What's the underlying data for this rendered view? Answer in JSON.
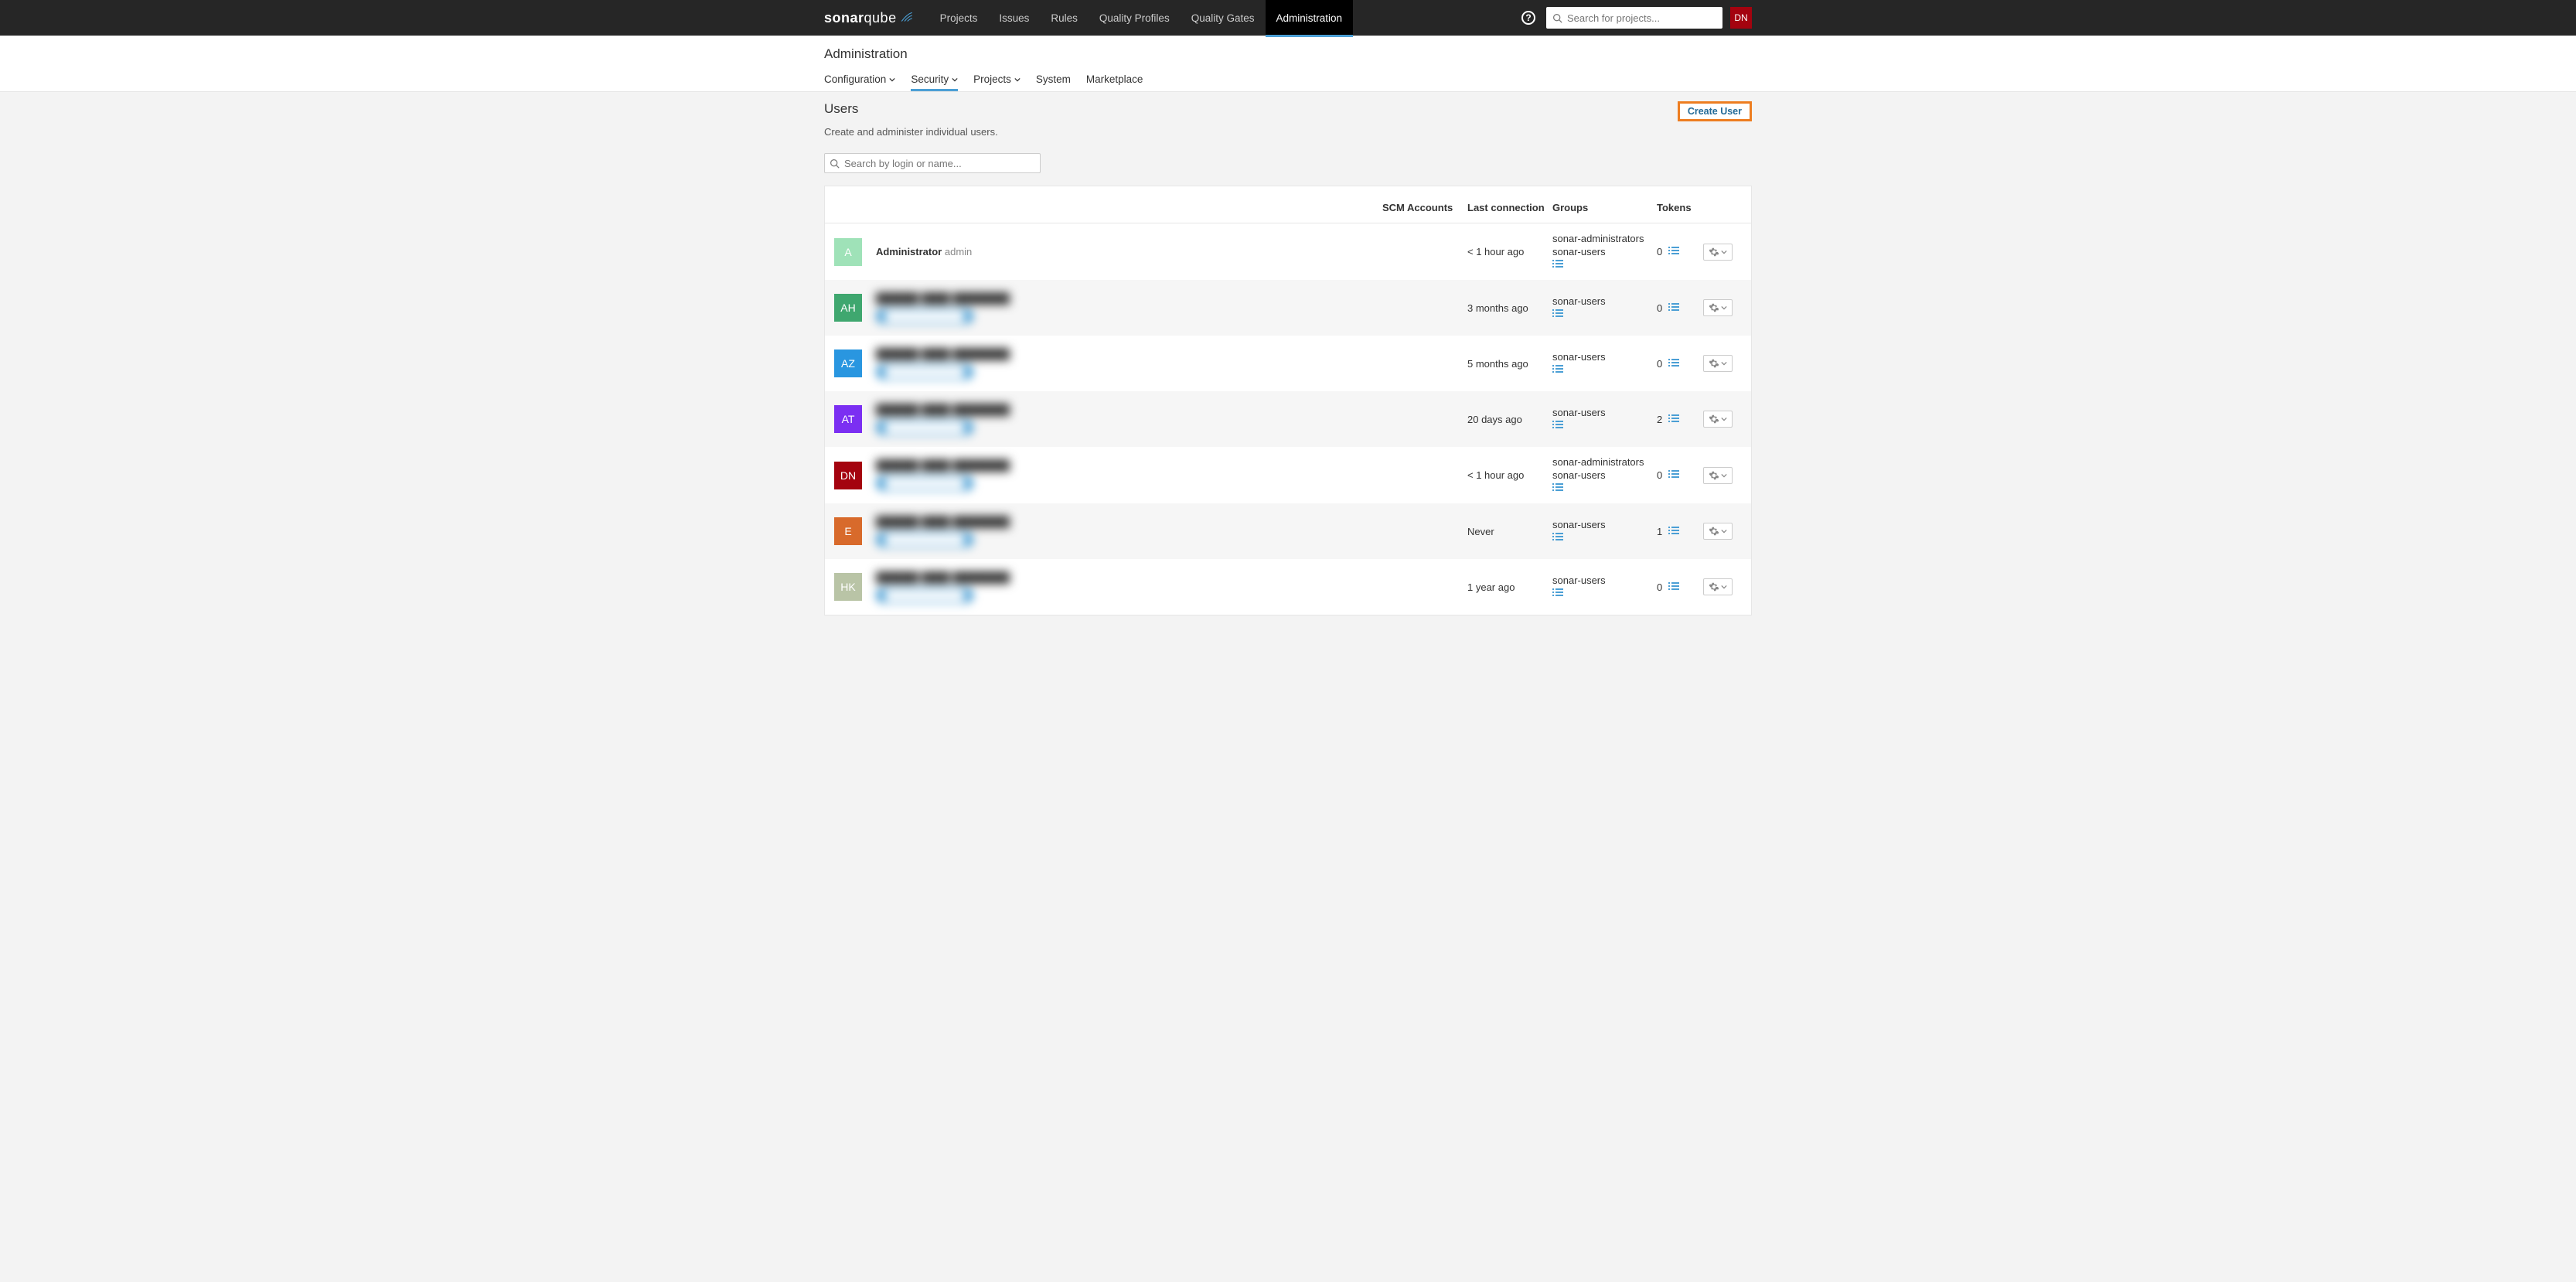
{
  "logo": {
    "part1": "sonar",
    "part2": "qube"
  },
  "nav": {
    "items": [
      "Projects",
      "Issues",
      "Rules",
      "Quality Profiles",
      "Quality Gates",
      "Administration"
    ],
    "active": "Administration"
  },
  "search": {
    "placeholder": "Search for projects..."
  },
  "current_user_initials": "DN",
  "subheader": {
    "title": "Administration",
    "tabs": [
      {
        "label": "Configuration",
        "caret": true
      },
      {
        "label": "Security",
        "caret": true,
        "active": true
      },
      {
        "label": "Projects",
        "caret": true
      },
      {
        "label": "System"
      },
      {
        "label": "Marketplace"
      }
    ]
  },
  "page": {
    "title": "Users",
    "description": "Create and administer individual users.",
    "create_button": "Create User",
    "filter_placeholder": "Search by login or name..."
  },
  "columns": {
    "scm": "SCM Accounts",
    "last": "Last connection",
    "groups": "Groups",
    "tokens": "Tokens"
  },
  "users": [
    {
      "initials": "A",
      "avatar_color": "#9fe2b8",
      "name": "Administrator",
      "login": "admin",
      "last": "< 1 hour ago",
      "groups": [
        "sonar-administrators",
        "sonar-users"
      ],
      "tokens": 0,
      "redacted": false
    },
    {
      "initials": "AH",
      "avatar_color": "#3fa76f",
      "last": "3 months ago",
      "groups": [
        "sonar-users"
      ],
      "tokens": 0,
      "redacted": true
    },
    {
      "initials": "AZ",
      "avatar_color": "#2996e0",
      "last": "5 months ago",
      "groups": [
        "sonar-users"
      ],
      "tokens": 0,
      "redacted": true
    },
    {
      "initials": "AT",
      "avatar_color": "#7b2ff2",
      "last": "20 days ago",
      "groups": [
        "sonar-users"
      ],
      "tokens": 2,
      "redacted": true
    },
    {
      "initials": "DN",
      "avatar_color": "#a4030f",
      "last": "< 1 hour ago",
      "groups": [
        "sonar-administrators",
        "sonar-users"
      ],
      "tokens": 0,
      "redacted": true
    },
    {
      "initials": "E",
      "avatar_color": "#d86a2b",
      "last": "Never",
      "groups": [
        "sonar-users"
      ],
      "tokens": 1,
      "redacted": true
    },
    {
      "initials": "HK",
      "avatar_color": "#b9c4a6",
      "last": "1 year ago",
      "groups": [
        "sonar-users"
      ],
      "tokens": 0,
      "redacted": true
    }
  ]
}
